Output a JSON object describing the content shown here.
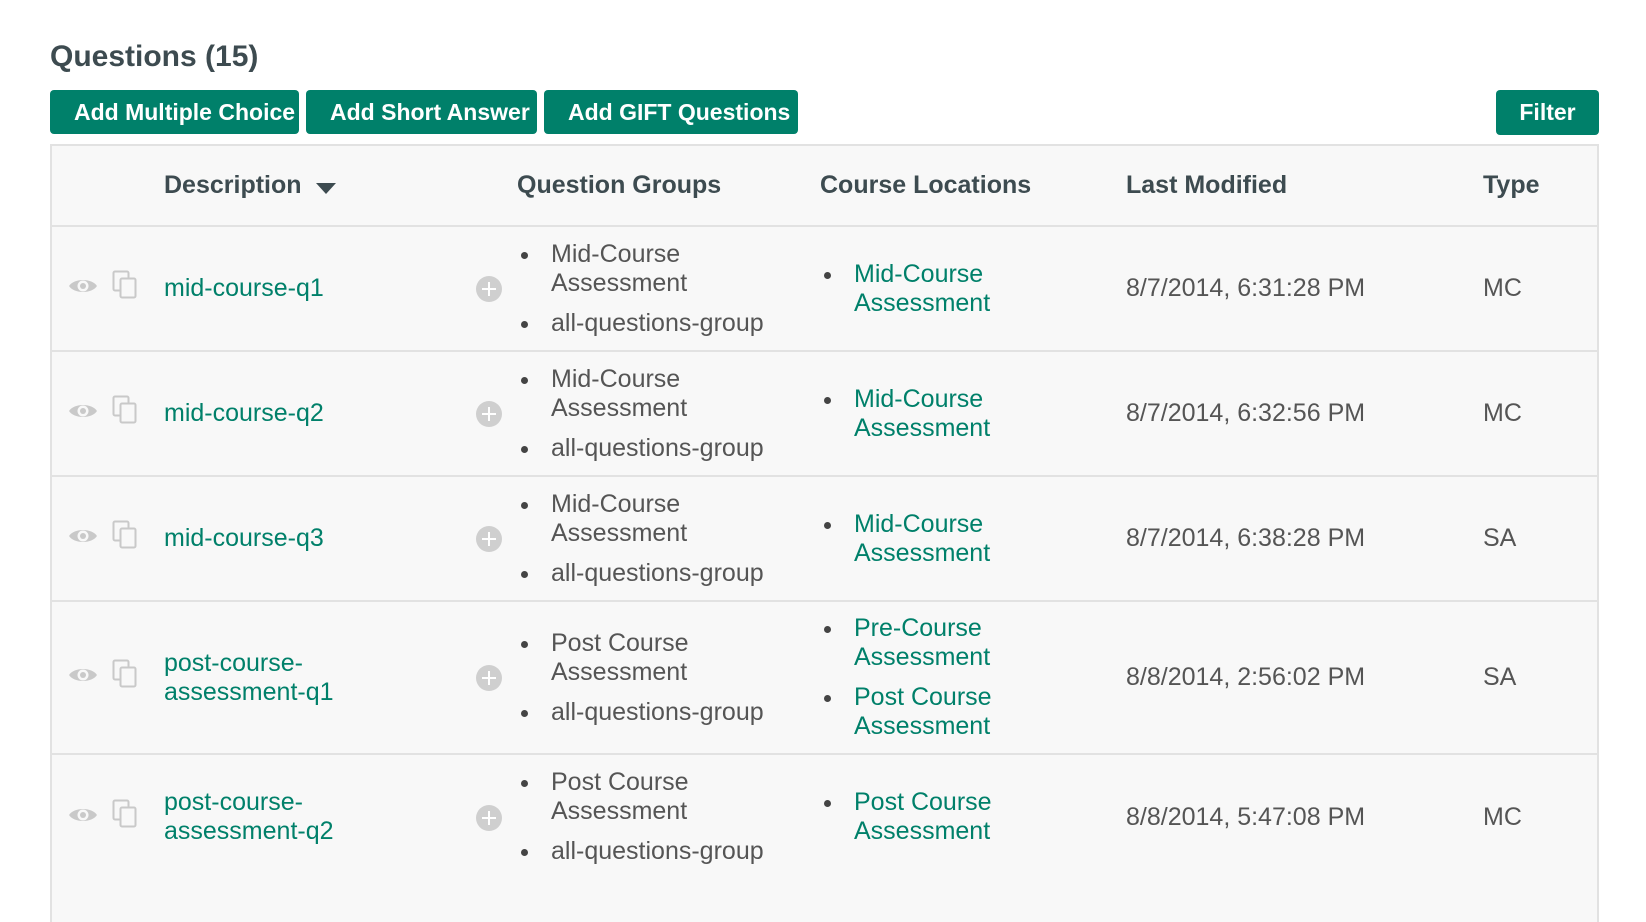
{
  "page": {
    "title": "Questions (15)"
  },
  "toolbar": {
    "add_mc_label": "Add Multiple Choice",
    "add_sa_label": "Add Short Answer",
    "add_gift_label": "Add GIFT Questions",
    "filter_label": "Filter"
  },
  "colors": {
    "accent": "#00806a",
    "header_text": "#3d4b50",
    "row_bg": "#f8f8f8",
    "border": "#e2e2e2"
  },
  "table": {
    "columns": {
      "description": "Description",
      "question_groups": "Question Groups",
      "course_locations": "Course Locations",
      "last_modified": "Last Modified",
      "type": "Type"
    },
    "sort": {
      "column": "description",
      "direction": "descending-arrow"
    },
    "rows": [
      {
        "description": "mid-course-q1",
        "groups": [
          "Mid-Course Assessment",
          "all-questions-group"
        ],
        "locations": [
          "Mid-Course Assessment"
        ],
        "last_modified": "8/7/2014, 6:31:28 PM",
        "type": "MC"
      },
      {
        "description": "mid-course-q2",
        "groups": [
          "Mid-Course Assessment",
          "all-questions-group"
        ],
        "locations": [
          "Mid-Course Assessment"
        ],
        "last_modified": "8/7/2014, 6:32:56 PM",
        "type": "MC"
      },
      {
        "description": "mid-course-q3",
        "groups": [
          "Mid-Course Assessment",
          "all-questions-group"
        ],
        "locations": [
          "Mid-Course Assessment"
        ],
        "last_modified": "8/7/2014, 6:38:28 PM",
        "type": "SA"
      },
      {
        "description": "post-course-assessment-q1",
        "groups": [
          "Post Course Assessment",
          "all-questions-group"
        ],
        "locations": [
          "Pre-Course Assessment",
          "Post Course Assessment"
        ],
        "last_modified": "8/8/2014, 2:56:02 PM",
        "type": "SA"
      },
      {
        "description": "post-course-assessment-q2",
        "groups": [
          "Post Course Assessment",
          "all-questions-group"
        ],
        "locations": [
          "Post Course Assessment"
        ],
        "last_modified": "8/8/2014, 5:47:08 PM",
        "type": "MC"
      }
    ]
  },
  "icons": {
    "preview": "eye-icon",
    "copy": "copy-icon",
    "add_to_group": "add-circle-icon",
    "sort": "caret-down-icon"
  }
}
